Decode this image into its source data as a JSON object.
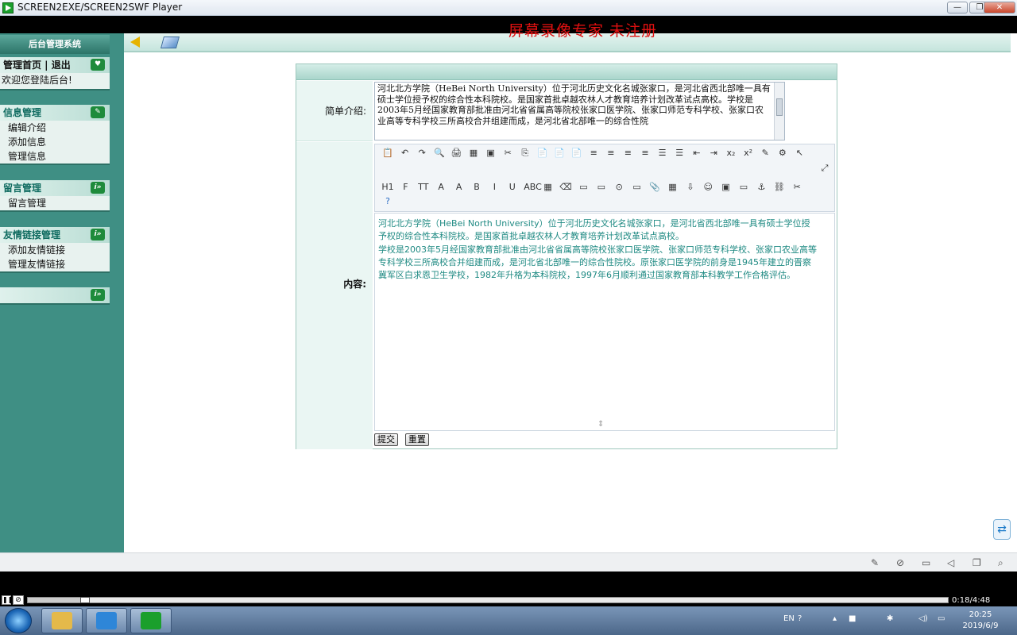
{
  "window": {
    "title": "SCREEN2EXE/SCREEN2SWF Player",
    "minimize": "—",
    "maximize": "❐",
    "close": "✕"
  },
  "watermark": "屏幕录像专家  未注册",
  "sidebar": {
    "header": "后台管理系统",
    "home": {
      "title": "管理首页 | 退出",
      "welcome": "欢迎您登陆后台!"
    },
    "info": {
      "title": "信息管理",
      "items": [
        "编辑介绍",
        "添加信息",
        "管理信息"
      ]
    },
    "message": {
      "title": "留言管理",
      "items": [
        "留言管理"
      ]
    },
    "links": {
      "title": "友情链接管理",
      "items": [
        "添加友情链接",
        "管理友情链接"
      ]
    }
  },
  "form": {
    "intro_label": "简单介绍:",
    "intro_text": "河北北方学院（HeBei North University）位于河北历史文化名城张家口，是河北省西北部唯一具有硕士学位授予权的综合性本科院校。是国家首批卓越农林人才教育培养计划改革试点高校。学校是2003年5月经国家教育部批准由河北省省属高等院校张家口医学院、张家口师范专科学校、张家口农业高等专科学校三所高校合并组建而成，是河北省北部唯一的综合性院",
    "content_label": "内容:",
    "content_p1": "河北北方学院（HeBei North University）位于河北历史文化名城张家口，是河北省西北部唯一具有硕士学位授予权的综合性本科院校。是国家首批卓越农林人才教育培养计划改革试点高校。",
    "content_p2": "学校是2003年5月经国家教育部批准由河北省省属高等院校张家口医学院、张家口师范专科学校、张家口农业高等专科学校三所高校合并组建而成，是河北省北部唯一的综合性院校。原张家口医学院的前身是1945年建立的晋察冀军区白求恩卫生学校，1982年升格为本科院校，1997年6月顺利通过国家教育部本科教学工作合格评估。",
    "submit": "提交",
    "reset": "重置"
  },
  "toolbar": {
    "row1": [
      "📋",
      "↶",
      "↷",
      "🔍",
      "🖨",
      "▦",
      "▣",
      "✂",
      "⎘",
      "📄",
      "📄",
      "📄",
      "≡",
      "≡",
      "≡",
      "≡",
      "☰",
      "☰",
      "⇤",
      "⇥",
      "x₂",
      "x²",
      "✎",
      "⚙",
      "↖",
      "⤢"
    ],
    "row2": [
      "H1",
      "F",
      "TT",
      "A",
      "A",
      "B",
      "I",
      "U",
      "ABC",
      "▦",
      "⌫",
      "▭",
      "▭",
      "⊙",
      "▭",
      "📎",
      "▦",
      "⇩",
      "☺",
      "▣",
      "▭",
      "⚓",
      "⛓",
      "✂",
      "?"
    ]
  },
  "player": {
    "time": "0:18/4:48",
    "progress": 0.0625
  },
  "taskbar": {
    "lang": "EN",
    "time": "20:25",
    "date": "2019/6/9"
  }
}
